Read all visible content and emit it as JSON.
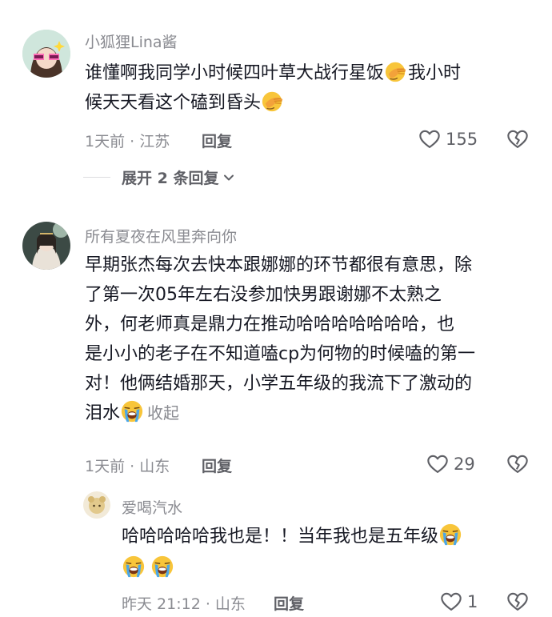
{
  "comments": [
    {
      "username": "小狐狸Lina酱",
      "lines": [
        "谁懂啊我同学小时候四叶草大战行星饭",
        "我小时",
        "候天天看这个磕到昏头"
      ],
      "time": "1天前 · 江苏",
      "reply_label": "回复",
      "likes": "155",
      "expand_label": "展开 2 条回复"
    },
    {
      "username": "所有夏夜在风里奔向你",
      "lines": [
        "早期张杰每次去快本跟娜娜的环节都很有意思，除",
        "了第一次05年左右没参加快男跟谢娜不太熟之",
        "外，何老师真是鼎力在推动哈哈哈哈哈哈哈，也",
        "是小小的老子在不知道嗑cp为何物的时候嗑的第一",
        "对！他俩结婚那天，小学五年级的我流下了激动的",
        "泪水"
      ],
      "collapse_label": "收起",
      "time": "1天前 · 山东",
      "reply_label": "回复",
      "likes": "29"
    },
    {
      "username": "爱喝汽水",
      "lines": [
        "哈哈哈哈哈我也是！！当年我也是五年级"
      ],
      "time": "昨天 21:12 · 山东",
      "reply_label": "回复",
      "likes": "1"
    }
  ],
  "icons": {
    "heart": "heart-outline-icon",
    "dislike": "broken-heart-icon",
    "facepalm": "facepalm-emoji-icon",
    "crying": "loudly-crying-emoji-icon",
    "chevron": "chevron-down-icon"
  }
}
